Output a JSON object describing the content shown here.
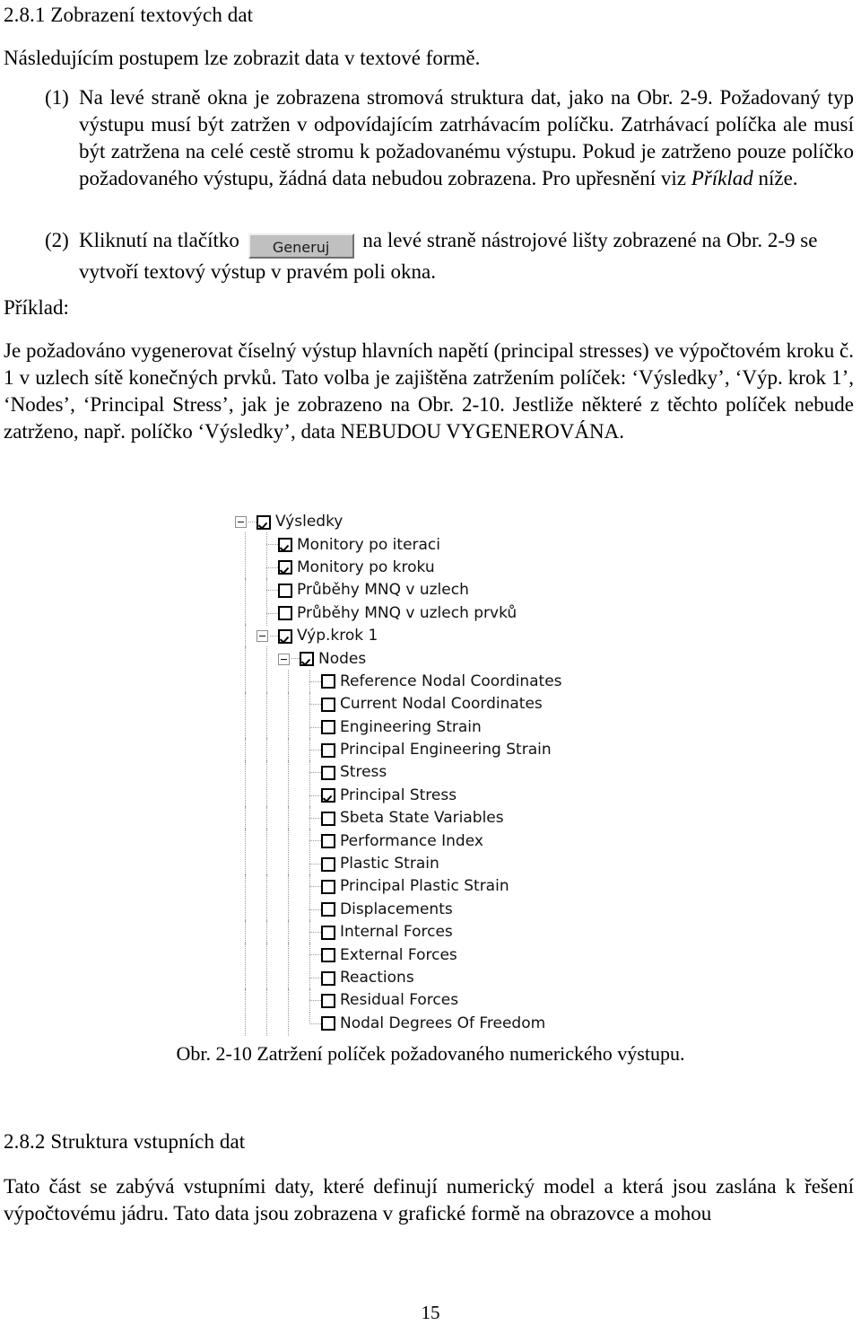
{
  "document": {
    "page_number": "15",
    "section_281": {
      "heading": "2.8.1 Zobrazení textových dat",
      "intro": "Následujícím postupem lze zobrazit data v textové formě.",
      "items": [
        {
          "marker": "(1)",
          "text_before_italic": "Na levé straně okna je zobrazena stromová struktura dat, jako na Obr. 2-9. Požadovaný typ výstupu musí být zatržen v odpovídajícím zatrhávacím políčku. Zatrhávací políčka ale musí být zatržena na celé cestě stromu k požadovanému výstupu. Pokud je zatrženo pouze políčko požadovaného výstupu, žádná data nebudou zobrazena. Pro upřesnění viz ",
          "italic": "Příklad",
          "text_after_italic": " níže."
        },
        {
          "marker": "(2)",
          "text_before_button": "Kliknutí na tlačítko ",
          "button_label": "Generuj",
          "text_after_button": " na levé straně nástrojové lišty zobrazené na Obr. 2-9 se vytvoří textový výstup v pravém poli okna."
        }
      ],
      "example_label": "Příklad:",
      "example_text": "Je požadováno vygenerovat číselný výstup hlavních napětí (principal stresses) ve výpočtovém kroku č. 1 v uzlech sítě konečných prvků. Tato volba je zajištěna zatržením políček: ‘Výsledky’, ‘Výp. krok 1’, ‘Nodes’, ‘Principal Stress’, jak je zobrazeno na Obr. 2-10. Jestliže některé z těchto políček nebude zatrženo, např. políčko ‘Výsledky’, data NEBUDOU VYGENEROVÁNA.",
      "figure_caption": "Obr. 2-10  Zatržení políček požadovaného numerického výstupu."
    },
    "section_282": {
      "heading": "2.8.2  Struktura vstupních dat",
      "text": "Tato část se zabývá vstupními daty, které definují numerický model a která jsou zaslána k řešení výpočtovému jádru. Tato data jsou zobrazena v grafické formě na obrazovce a mohou"
    }
  },
  "tree": {
    "nodes": [
      {
        "label": "Výsledky",
        "depth": 0,
        "checked": true,
        "expander": "minus",
        "rails": [],
        "conn": "none"
      },
      {
        "label": "Monitory po iteraci",
        "depth": 1,
        "checked": true,
        "expander": "none",
        "rails": [
          "line"
        ],
        "conn": "tee"
      },
      {
        "label": "Monitory po kroku",
        "depth": 1,
        "checked": true,
        "expander": "none",
        "rails": [
          "line"
        ],
        "conn": "tee"
      },
      {
        "label": "Průběhy MNQ v uzlech",
        "depth": 1,
        "checked": false,
        "expander": "none",
        "rails": [
          "line"
        ],
        "conn": "tee"
      },
      {
        "label": "Průběhy MNQ v uzlech prvků",
        "depth": 1,
        "checked": false,
        "expander": "none",
        "rails": [
          "line"
        ],
        "conn": "tee"
      },
      {
        "label": "Výp.krok 1",
        "depth": 1,
        "checked": true,
        "expander": "minus",
        "rails": [
          "line"
        ],
        "conn": "none"
      },
      {
        "label": "Nodes",
        "depth": 2,
        "checked": true,
        "expander": "minus",
        "rails": [
          "line",
          "line"
        ],
        "conn": "none"
      },
      {
        "label": "Reference Nodal Coordinates",
        "depth": 3,
        "checked": false,
        "expander": "none",
        "rails": [
          "line",
          "line",
          "line"
        ],
        "conn": "tee"
      },
      {
        "label": "Current Nodal Coordinates",
        "depth": 3,
        "checked": false,
        "expander": "none",
        "rails": [
          "line",
          "line",
          "line"
        ],
        "conn": "tee"
      },
      {
        "label": "Engineering Strain",
        "depth": 3,
        "checked": false,
        "expander": "none",
        "rails": [
          "line",
          "line",
          "line"
        ],
        "conn": "tee"
      },
      {
        "label": "Principal Engineering Strain",
        "depth": 3,
        "checked": false,
        "expander": "none",
        "rails": [
          "line",
          "line",
          "line"
        ],
        "conn": "tee"
      },
      {
        "label": "Stress",
        "depth": 3,
        "checked": false,
        "expander": "none",
        "rails": [
          "line",
          "line",
          "line"
        ],
        "conn": "tee"
      },
      {
        "label": "Principal Stress",
        "depth": 3,
        "checked": true,
        "expander": "none",
        "rails": [
          "line",
          "line",
          "line"
        ],
        "conn": "tee"
      },
      {
        "label": "Sbeta State Variables",
        "depth": 3,
        "checked": false,
        "expander": "none",
        "rails": [
          "line",
          "line",
          "line"
        ],
        "conn": "tee"
      },
      {
        "label": "Performance Index",
        "depth": 3,
        "checked": false,
        "expander": "none",
        "rails": [
          "line",
          "line",
          "line"
        ],
        "conn": "tee"
      },
      {
        "label": "Plastic Strain",
        "depth": 3,
        "checked": false,
        "expander": "none",
        "rails": [
          "line",
          "line",
          "line"
        ],
        "conn": "tee"
      },
      {
        "label": "Principal Plastic Strain",
        "depth": 3,
        "checked": false,
        "expander": "none",
        "rails": [
          "line",
          "line",
          "line"
        ],
        "conn": "tee"
      },
      {
        "label": "Displacements",
        "depth": 3,
        "checked": false,
        "expander": "none",
        "rails": [
          "line",
          "line",
          "line"
        ],
        "conn": "tee"
      },
      {
        "label": "Internal Forces",
        "depth": 3,
        "checked": false,
        "expander": "none",
        "rails": [
          "line",
          "line",
          "line"
        ],
        "conn": "tee"
      },
      {
        "label": "External Forces",
        "depth": 3,
        "checked": false,
        "expander": "none",
        "rails": [
          "line",
          "line",
          "line"
        ],
        "conn": "tee"
      },
      {
        "label": "Reactions",
        "depth": 3,
        "checked": false,
        "expander": "none",
        "rails": [
          "line",
          "line",
          "line"
        ],
        "conn": "tee"
      },
      {
        "label": "Residual Forces",
        "depth": 3,
        "checked": false,
        "expander": "none",
        "rails": [
          "line",
          "line",
          "line"
        ],
        "conn": "tee"
      },
      {
        "label": "Nodal Degrees Of Freedom",
        "depth": 3,
        "checked": false,
        "expander": "none",
        "rails": [
          "line",
          "line",
          "line"
        ],
        "conn": "last"
      }
    ]
  },
  "colors": {
    "button_face": "#c0c0c0",
    "button_highlight": "#efefef",
    "button_shadow": "#6e6e6e",
    "tree_line": "#9a9a9a",
    "text": "#000000"
  }
}
